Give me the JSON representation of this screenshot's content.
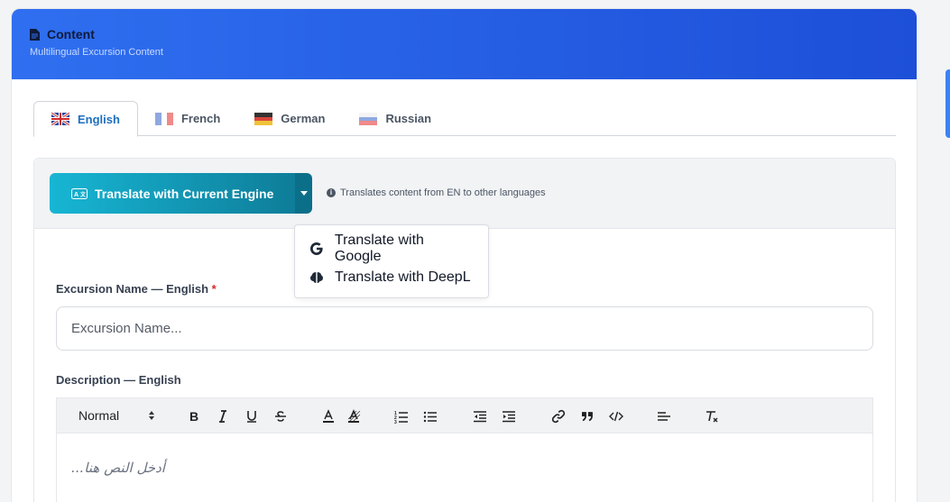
{
  "header": {
    "title": "Content",
    "subtitle": "Multilingual Excursion Content",
    "icon": "document-icon",
    "gradient": [
      "#2f6ff0",
      "#1d4fd8"
    ]
  },
  "tabs": [
    {
      "label": "English",
      "active": true,
      "flag": "uk-flag-icon"
    },
    {
      "label": "French",
      "active": false,
      "flag": "france-flag-icon"
    },
    {
      "label": "German",
      "active": false,
      "flag": "germany-flag-icon"
    },
    {
      "label": "Russian",
      "active": false,
      "flag": "russia-flag-icon"
    }
  ],
  "translate": {
    "button_label": "Translate with Current Engine",
    "hint": "Translates content from EN to other languages",
    "menu": [
      {
        "label": "Translate with Google",
        "icon": "google-icon"
      },
      {
        "label": "Translate with DeepL",
        "icon": "deepl-icon"
      }
    ]
  },
  "form": {
    "name_label": "Excursion Name — English",
    "required_mark": "*",
    "name_placeholder": "Excursion Name...",
    "desc_label": "Description — English",
    "editor": {
      "format_value": "Normal",
      "placeholder": "أدخل النص هنا..."
    }
  },
  "colors": {
    "accent": "#1d6fc0",
    "translate_button": "#0e7d99"
  }
}
